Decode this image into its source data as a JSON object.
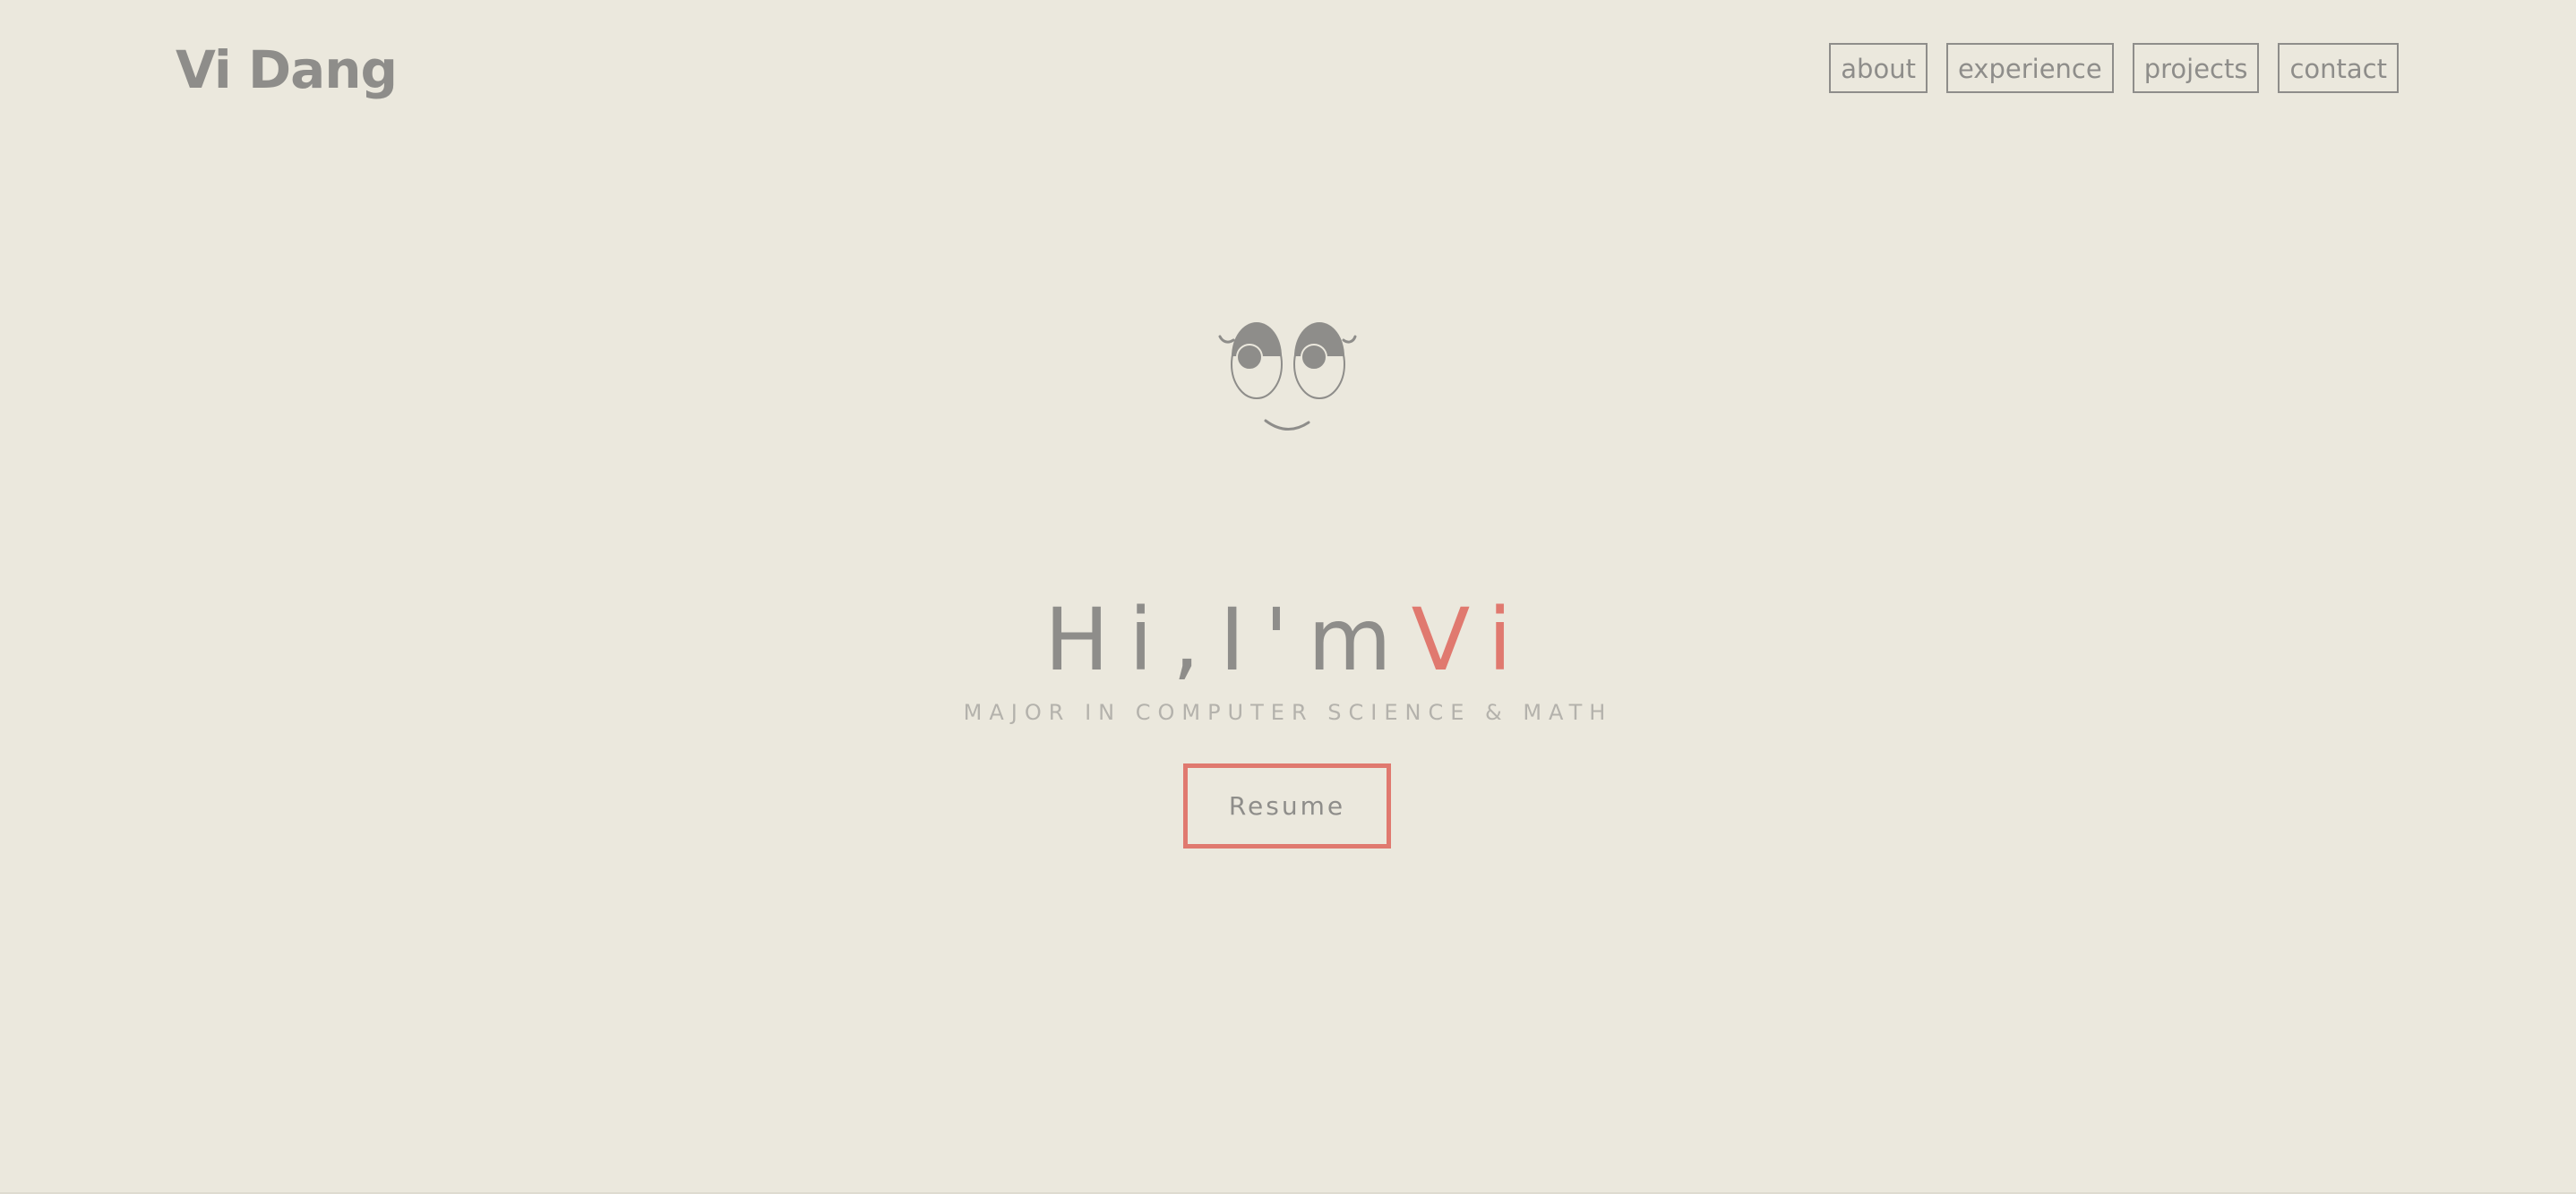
{
  "header": {
    "brand": "Vi Dang",
    "nav": [
      {
        "label": "about"
      },
      {
        "label": "experience"
      },
      {
        "label": "projects"
      },
      {
        "label": "contact"
      }
    ]
  },
  "hero": {
    "greeting": "Hi,I'm",
    "name": "Vi",
    "subtitle": "MAJOR IN COMPUTER SCIENCE & MATH",
    "resume_label": "Resume"
  },
  "colors": {
    "background": "#ebe8dd",
    "text": "#8e8d8a",
    "accent": "#e0796f",
    "subtitle": "#b4b2ac"
  }
}
